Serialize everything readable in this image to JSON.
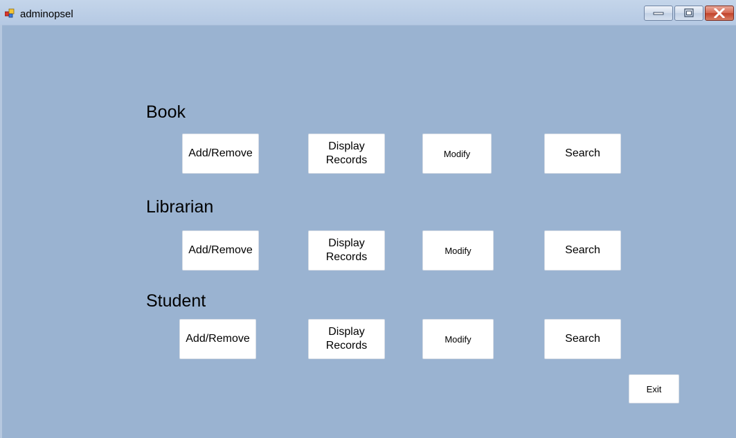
{
  "window": {
    "title": "adminopsel",
    "controls": {
      "minimize_icon": "minimize-icon",
      "maximize_icon": "maximize-icon",
      "close_icon": "close-icon"
    }
  },
  "sections": {
    "book": {
      "title": "Book",
      "add_remove": "Add/Remove",
      "display_records": "Display\nRecords",
      "modify": "Modify",
      "search": "Search"
    },
    "librarian": {
      "title": "Librarian",
      "add_remove": "Add/Remove",
      "display_records": "Display\nRecords",
      "modify": "Modify",
      "search": "Search"
    },
    "student": {
      "title": "Student",
      "add_remove": "Add/Remove",
      "display_records": "Display\nRecords",
      "modify": "Modify",
      "search": "Search"
    }
  },
  "exit_label": "Exit",
  "colors": {
    "background": "#9ab3d1",
    "button": "#ffffff",
    "close_button": "#c2422a"
  }
}
